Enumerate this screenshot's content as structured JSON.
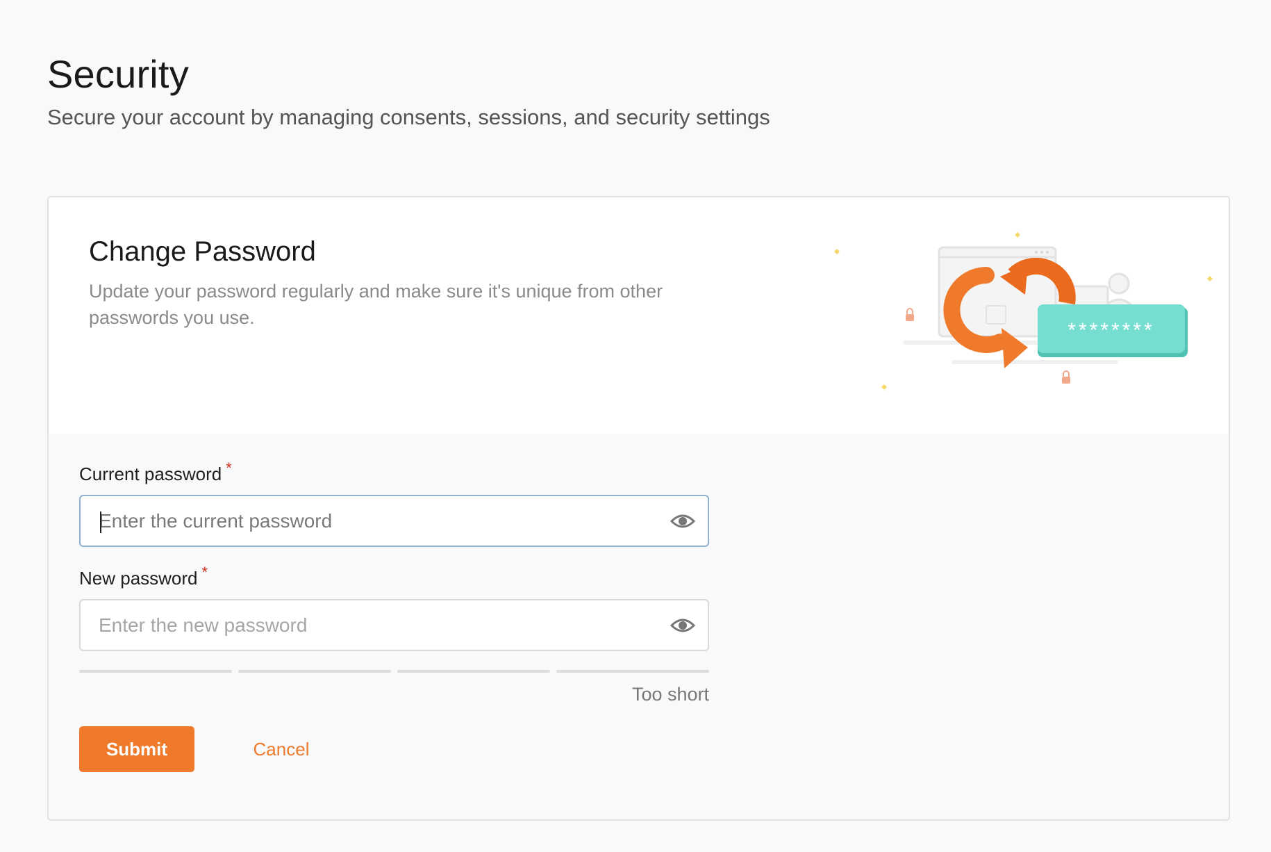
{
  "page": {
    "title": "Security",
    "subtitle": "Secure your account by managing consents, sessions, and security settings"
  },
  "change_password": {
    "title": "Change Password",
    "description": "Update your password regularly and make sure it's unique from other passwords you use.",
    "illustration_mask": "********",
    "current_password": {
      "label": "Current password",
      "required_mark": "*",
      "placeholder": "Enter the current password",
      "value": ""
    },
    "new_password": {
      "label": "New password",
      "required_mark": "*",
      "placeholder": "Enter the new password",
      "value": ""
    },
    "strength": {
      "text": "Too short",
      "segments_filled": 0,
      "segments_total": 4
    },
    "submit_label": "Submit",
    "cancel_label": "Cancel"
  },
  "colors": {
    "accent": "#f07a2c",
    "required": "#d0311b",
    "focus_border": "#8fb0cf",
    "teal": "#5fd3c5"
  },
  "icons": {
    "eye": "eye-icon",
    "lock": "lock-icon",
    "refresh": "refresh-arrows-icon",
    "sparkle": "sparkle-icon"
  }
}
